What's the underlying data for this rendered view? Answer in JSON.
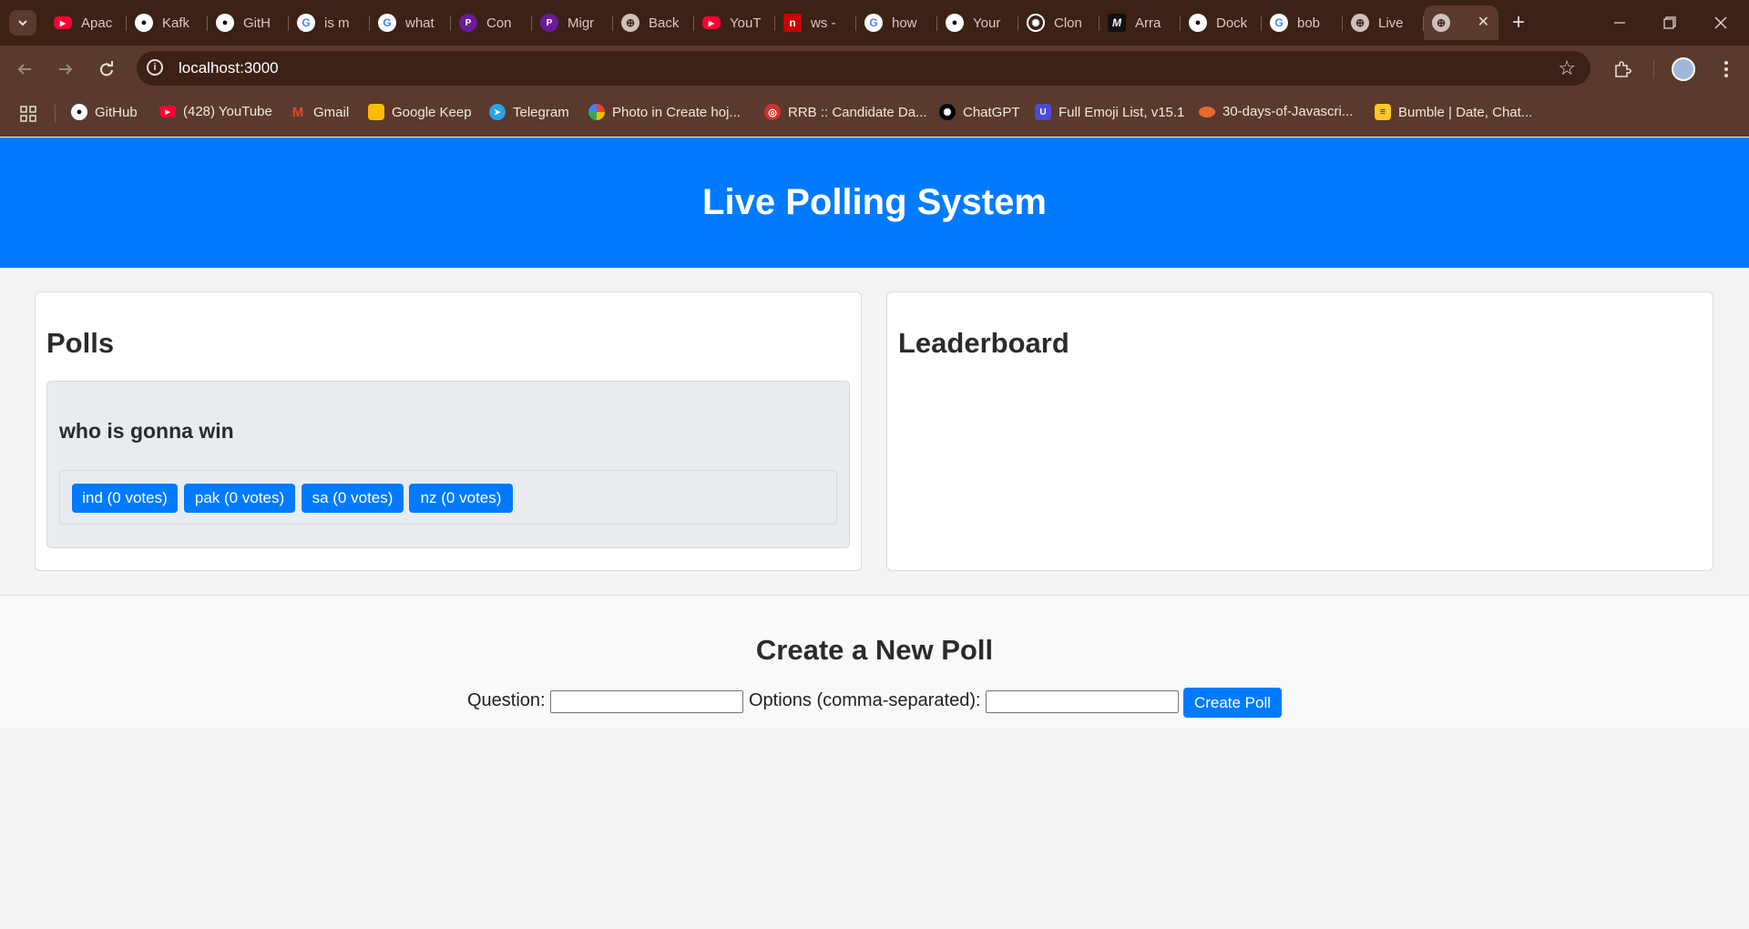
{
  "browser": {
    "tabs": [
      {
        "title": "Apac",
        "icon": "youtube-icon",
        "color": "#ff0033"
      },
      {
        "title": "Kafk",
        "icon": "github-icon",
        "color": "#ffffff"
      },
      {
        "title": "GitH",
        "icon": "github-icon",
        "color": "#ffffff"
      },
      {
        "title": "is m",
        "icon": "google-icon",
        "color": "#ffffff"
      },
      {
        "title": "what",
        "icon": "google-icon",
        "color": "#ffffff"
      },
      {
        "title": "Con",
        "icon": "perplexity-icon",
        "color": "#6a1b9a"
      },
      {
        "title": "Migr",
        "icon": "perplexity-icon",
        "color": "#6a1b9a"
      },
      {
        "title": "Back",
        "icon": "globe-icon",
        "color": "#cfc0ba"
      },
      {
        "title": "YouT",
        "icon": "youtube-icon",
        "color": "#ff0033"
      },
      {
        "title": "ws -",
        "icon": "npm-icon",
        "color": "#cb0000"
      },
      {
        "title": "how",
        "icon": "google-icon",
        "color": "#ffffff"
      },
      {
        "title": "Your",
        "icon": "github-icon",
        "color": "#ffffff"
      },
      {
        "title": "Clon",
        "icon": "chatgpt-icon",
        "color": "#ffffff"
      },
      {
        "title": "Arra",
        "icon": "mdn-icon",
        "color": "#111111"
      },
      {
        "title": "Dock",
        "icon": "github-icon",
        "color": "#ffffff"
      },
      {
        "title": "bob",
        "icon": "google-icon",
        "color": "#ffffff"
      },
      {
        "title": "Live",
        "icon": "globe-icon",
        "color": "#cfc0ba"
      },
      {
        "title": "",
        "icon": "globe-icon",
        "color": "#cfc0ba",
        "active": true
      }
    ],
    "new_tab": "+",
    "url": "localhost:3000",
    "bookmarks": [
      {
        "label": "GitHub",
        "icon": "github-icon",
        "color": "#ffffff"
      },
      {
        "label": "(428) YouTube",
        "icon": "youtube-icon",
        "color": "#ff0033"
      },
      {
        "label": "Gmail",
        "icon": "gmail-icon",
        "color": "#ea4335"
      },
      {
        "label": "Google Keep",
        "icon": "keep-icon",
        "color": "#fbbc04"
      },
      {
        "label": "Telegram",
        "icon": "telegram-icon",
        "color": "#2aa3df"
      },
      {
        "label": "Photo in Create hoj...",
        "icon": "photos-icon",
        "color": "#34a853"
      },
      {
        "label": "RRB :: Candidate Da...",
        "icon": "rrb-icon",
        "color": "#d32f2f"
      },
      {
        "label": "ChatGPT",
        "icon": "chatgpt-icon",
        "color": "#000000"
      },
      {
        "label": "Full Emoji List, v15.1",
        "icon": "unicode-icon",
        "color": "#4b4bd8"
      },
      {
        "label": "30-days-of-Javascri...",
        "icon": "js-icon",
        "color": "#e8692e"
      },
      {
        "label": "Bumble | Date, Chat...",
        "icon": "bumble-icon",
        "color": "#ffc629"
      }
    ]
  },
  "app": {
    "title": "Live Polling System",
    "polls_heading": "Polls",
    "leaderboard_heading": "Leaderboard",
    "polls": [
      {
        "question": "who is gonna win",
        "options": [
          {
            "label": "ind (0 votes)"
          },
          {
            "label": "pak (0 votes)"
          },
          {
            "label": "sa (0 votes)"
          },
          {
            "label": "nz (0 votes)"
          }
        ]
      }
    ],
    "create": {
      "heading": "Create a New Poll",
      "question_label": "Question:",
      "options_label": "Options (comma-separated):",
      "question_value": "",
      "options_value": "",
      "submit_label": "Create Poll"
    },
    "colors": {
      "primary": "#007bff"
    }
  }
}
